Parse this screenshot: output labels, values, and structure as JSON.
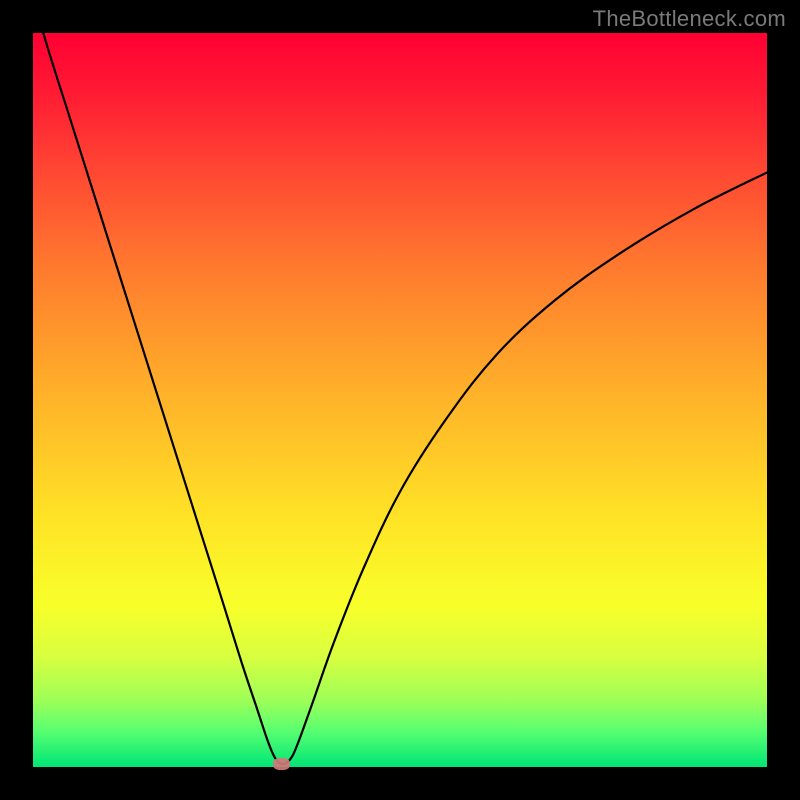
{
  "watermark": "TheBottleneck.com",
  "colors": {
    "frame": "#000000",
    "curve": "#000000",
    "marker": "#d07a78",
    "gradient_top": "#ff0033",
    "gradient_bottom": "#00e676"
  },
  "chart_data": {
    "type": "line",
    "title": "",
    "xlabel": "",
    "ylabel": "",
    "xlim": [
      0,
      100
    ],
    "ylim": [
      0,
      100
    ],
    "grid": false,
    "legend_position": "none",
    "series": [
      {
        "name": "bottleneck-curve",
        "x": [
          0,
          2,
          5,
          8,
          11,
          14,
          17,
          20,
          23,
          26,
          28.5,
          30.5,
          32,
          33,
          34,
          35,
          36,
          38,
          41,
          45,
          50,
          56,
          63,
          71,
          80,
          90,
          100
        ],
        "values": [
          105,
          98,
          88.5,
          79,
          69.5,
          60,
          50.5,
          41,
          31.5,
          22,
          14,
          8,
          3.5,
          1.2,
          0.4,
          1.0,
          3.0,
          8.5,
          17,
          27,
          37.5,
          47,
          56,
          63.5,
          70,
          76,
          81
        ]
      }
    ],
    "annotations": [
      {
        "name": "min-marker",
        "x": 33.8,
        "y": 0.4,
        "shape": "rounded-pill",
        "color": "#d07a78"
      }
    ]
  }
}
